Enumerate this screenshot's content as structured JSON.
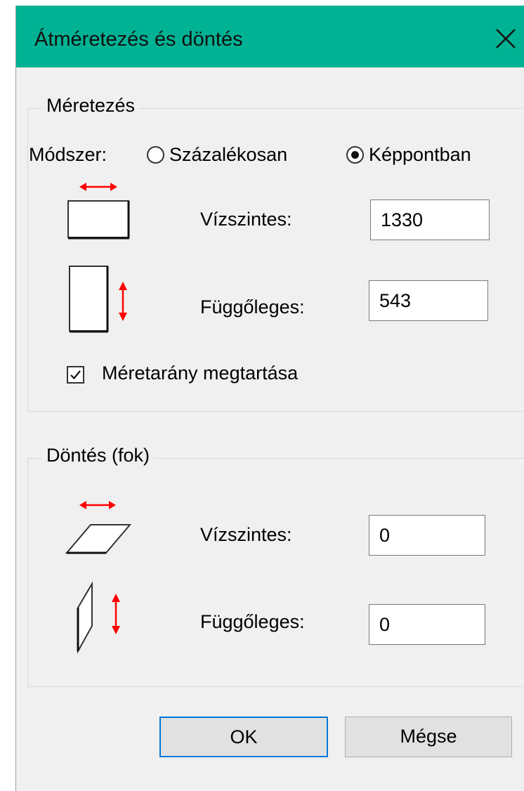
{
  "window": {
    "title": "Átméretezés és döntés",
    "accent_color": "#00b294",
    "close_icon": "close-icon"
  },
  "resize": {
    "group_label": "Méretezés",
    "method_label": "Módszer:",
    "options": [
      {
        "label": "Százalékosan",
        "selected": false
      },
      {
        "label": "Képpontban",
        "selected": true
      }
    ],
    "horizontal_label": "Vízszintes:",
    "horizontal_value": "1330",
    "vertical_label": "Függőleges:",
    "vertical_value": "543",
    "keep_ratio_label": "Méretarány megtartása",
    "keep_ratio_checked": true,
    "icons": [
      "resize-horizontal-icon",
      "resize-vertical-icon"
    ]
  },
  "skew": {
    "group_label": "Döntés (fok)",
    "horizontal_label": "Vízszintes:",
    "horizontal_value": "0",
    "vertical_label": "Függőleges:",
    "vertical_value": "0",
    "icons": [
      "skew-horizontal-icon",
      "skew-vertical-icon"
    ]
  },
  "buttons": {
    "ok_label": "OK",
    "cancel_label": "Mégse"
  },
  "colors": {
    "arrow": "#ff0000",
    "default_button_border": "#0078d7"
  }
}
